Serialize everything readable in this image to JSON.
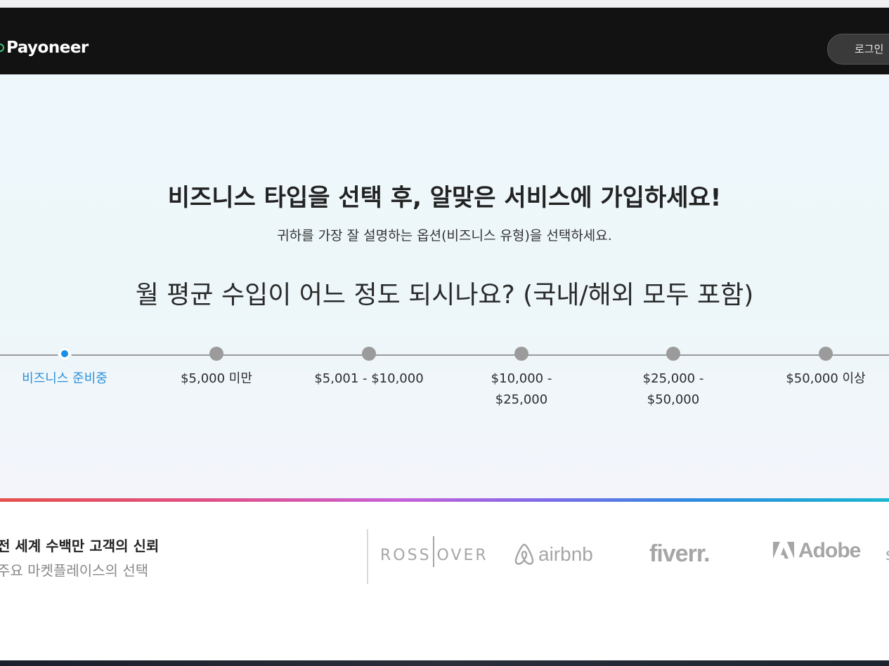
{
  "header": {
    "brand": "Payoneer",
    "login_label": "로그인"
  },
  "hero": {
    "title": "비즈니스 타입을 선택 후, 알맞은 서비스에 가입하세요!",
    "subtitle": "귀하를 가장 잘 설명하는 옵션(비즈니스 유형)을 선택하세요.",
    "question": "월 평균 수입이 어느 정도 되시나요? (국내/해외 모두 포함)",
    "income_options": [
      {
        "label": "비즈니스 준비중",
        "selected": true
      },
      {
        "label": "$5,000 미만",
        "selected": false
      },
      {
        "label": "$5,001 - $10,000",
        "selected": false
      },
      {
        "label": "$10,000 -\n$25,000",
        "selected": false
      },
      {
        "label": "$25,000 -\n$50,000",
        "selected": false
      },
      {
        "label": "$50,000 이상",
        "selected": false
      }
    ]
  },
  "trust": {
    "title": "전 세계 수백만 고객의 신뢰",
    "subtitle": "주요 마켓플레이스의 선택",
    "brands": [
      "ROSS",
      "OVER",
      "airbnb",
      "fiverr.",
      "Adobe",
      "s"
    ]
  },
  "colors": {
    "header_bg": "#121212",
    "accent_blue": "#1a8fe8",
    "logo_green": "#3ac77e",
    "hero_bg": "#eef7fb"
  },
  "icons": {
    "logo": "payoneer-ring-icon",
    "airbnb": "airbnb-belo-icon",
    "adobe": "adobe-a-icon"
  }
}
